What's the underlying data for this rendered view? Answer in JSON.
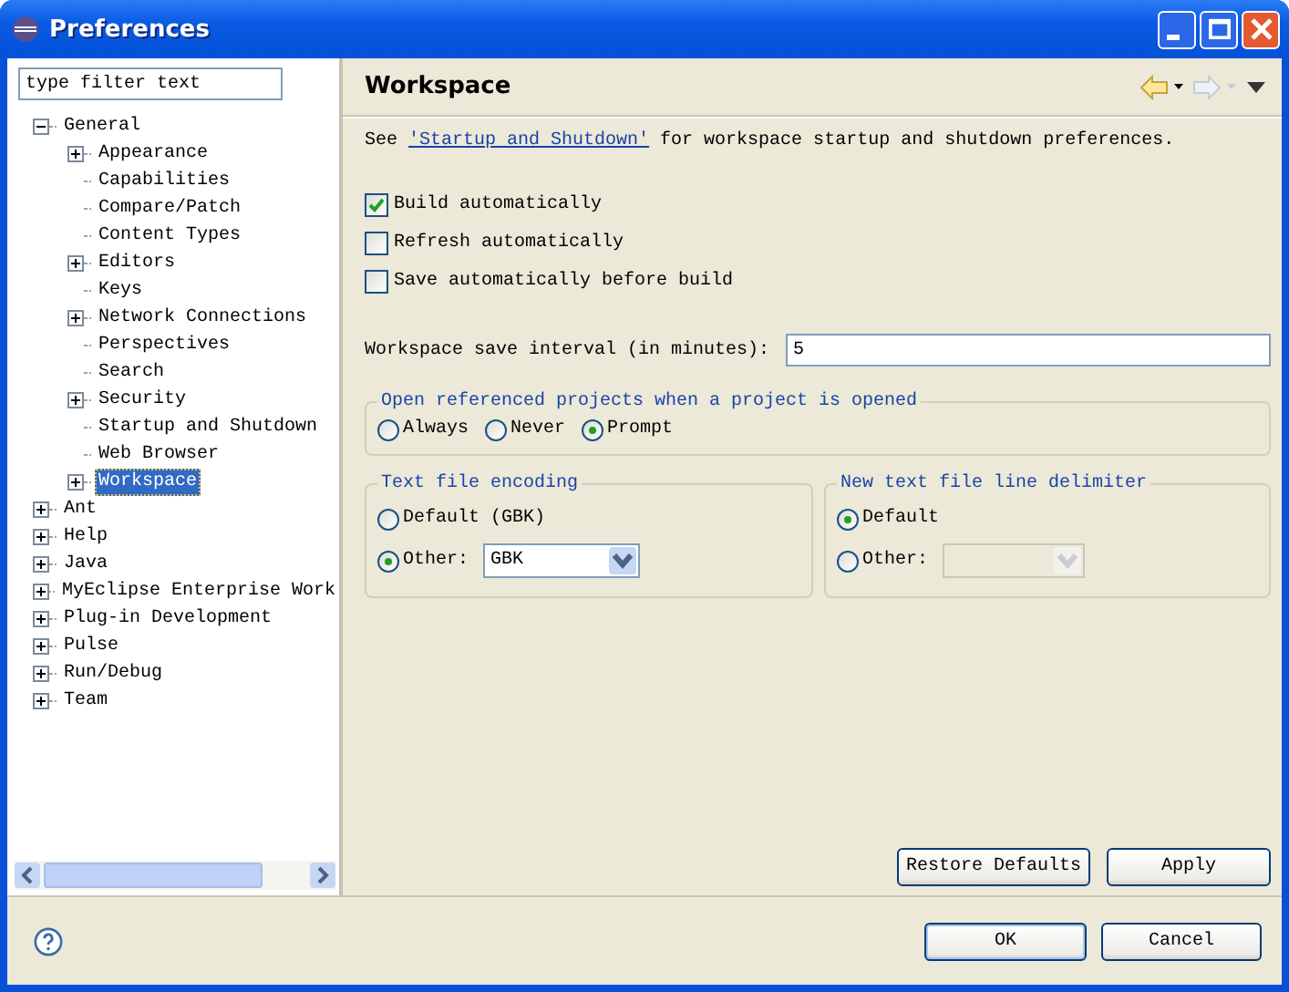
{
  "window": {
    "title": "Preferences"
  },
  "filter": {
    "placeholder": "type filter text"
  },
  "tree": [
    {
      "label": "General",
      "expanded": true,
      "selected": false,
      "children": [
        {
          "label": "Appearance",
          "expanded": false,
          "selected": false
        },
        {
          "label": "Capabilities",
          "selected": false
        },
        {
          "label": "Compare/Patch",
          "selected": false
        },
        {
          "label": "Content Types",
          "selected": false
        },
        {
          "label": "Editors",
          "expanded": false,
          "selected": false
        },
        {
          "label": "Keys",
          "selected": false
        },
        {
          "label": "Network Connections",
          "expanded": false,
          "selected": false
        },
        {
          "label": "Perspectives",
          "selected": false
        },
        {
          "label": "Search",
          "selected": false
        },
        {
          "label": "Security",
          "expanded": false,
          "selected": false
        },
        {
          "label": "Startup and Shutdown",
          "selected": false
        },
        {
          "label": "Web Browser",
          "selected": false
        },
        {
          "label": "Workspace",
          "expanded": false,
          "selected": true
        }
      ]
    },
    {
      "label": "Ant",
      "expanded": false,
      "selected": false
    },
    {
      "label": "Help",
      "expanded": false,
      "selected": false
    },
    {
      "label": "Java",
      "expanded": false,
      "selected": false
    },
    {
      "label": "MyEclipse Enterprise Work",
      "expanded": false,
      "selected": false
    },
    {
      "label": "Plug-in Development",
      "expanded": false,
      "selected": false
    },
    {
      "label": "Pulse",
      "expanded": false,
      "selected": false
    },
    {
      "label": "Run/Debug",
      "expanded": false,
      "selected": false
    },
    {
      "label": "Team",
      "expanded": false,
      "selected": false
    }
  ],
  "page": {
    "title": "Workspace",
    "intro": {
      "before": "See ",
      "link": "'Startup and Shutdown'",
      "after": " for workspace startup and shutdown preferences."
    },
    "options": [
      {
        "label": "Build automatically",
        "checked": true
      },
      {
        "label": "Refresh automatically",
        "checked": false
      },
      {
        "label": "Save automatically before build",
        "checked": false
      }
    ],
    "save_interval": {
      "label": "Workspace save interval (in minutes):",
      "value": "5"
    },
    "open_referenced": {
      "title": "Open referenced projects when a project is opened",
      "choices": [
        {
          "label": "Always",
          "selected": false
        },
        {
          "label": "Never",
          "selected": false
        },
        {
          "label": "Prompt",
          "selected": true
        }
      ]
    },
    "encoding": {
      "title": "Text file encoding",
      "choices": [
        {
          "label": "Default (GBK)",
          "selected": false
        },
        {
          "label": "Other:",
          "selected": true
        }
      ],
      "combo": {
        "value": "GBK",
        "disabled": false
      }
    },
    "line_delimiter": {
      "title": "New text file line delimiter",
      "choices": [
        {
          "label": "Default",
          "selected": true
        },
        {
          "label": "Other:",
          "selected": false
        }
      ],
      "combo": {
        "disabled": true
      }
    },
    "buttons": [
      "Restore Defaults",
      "Apply"
    ]
  },
  "dialog_buttons": [
    "OK",
    "Cancel"
  ]
}
